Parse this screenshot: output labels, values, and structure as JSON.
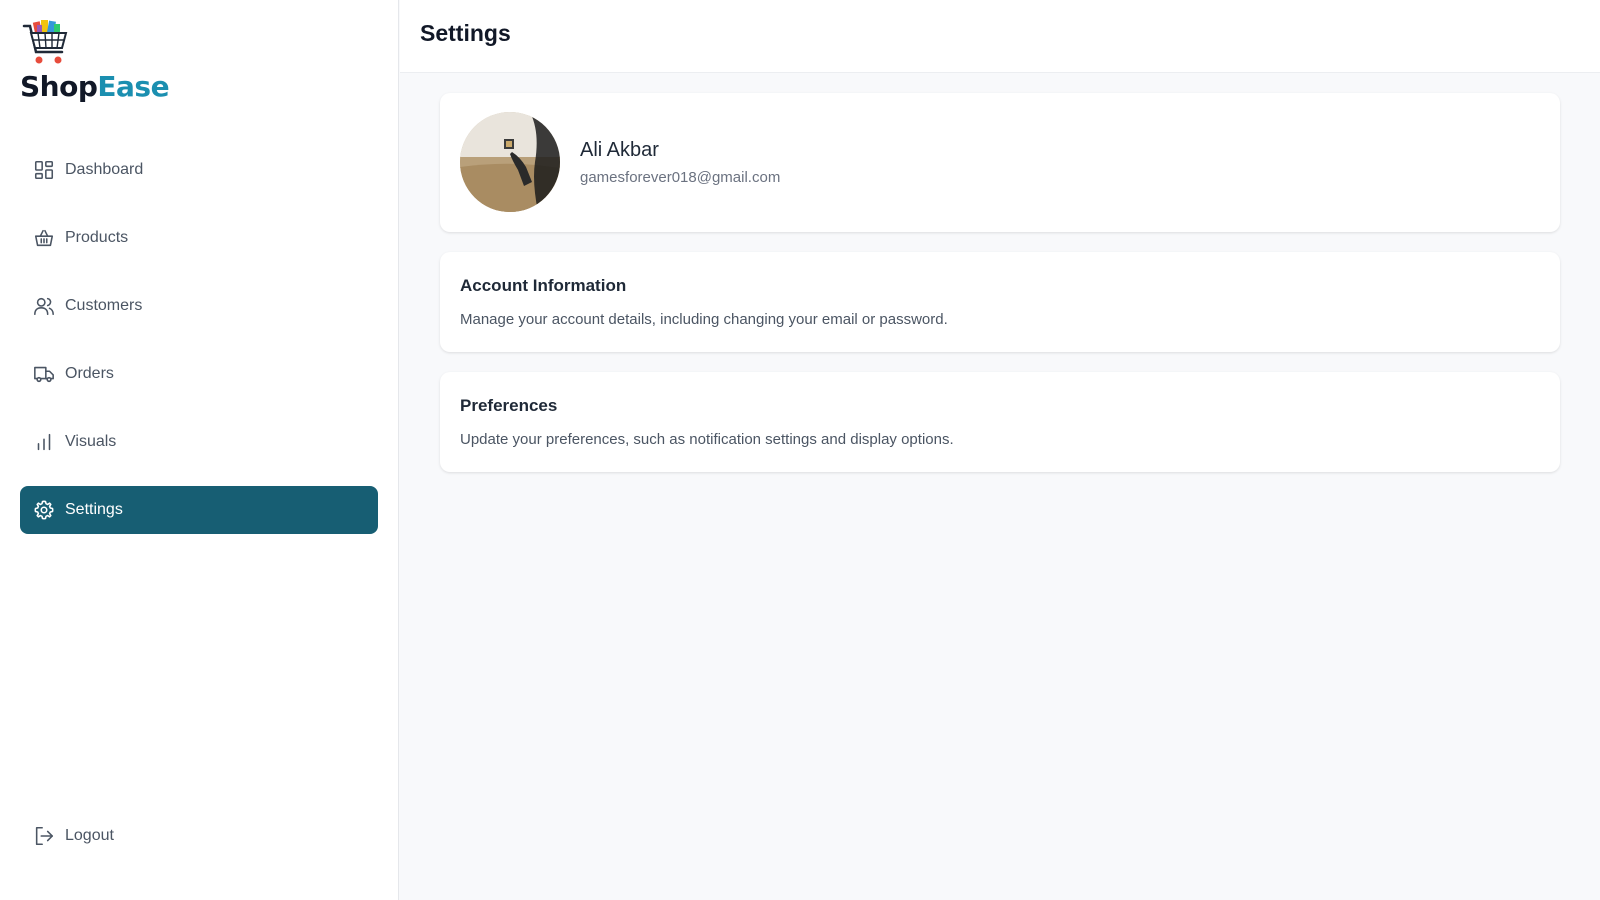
{
  "brand": {
    "name_part1": "Shop",
    "name_part2": "Ease",
    "accent_color": "#1b8fb0",
    "logo_icon": "shopping-cart-icon"
  },
  "sidebar": {
    "items": [
      {
        "label": "Dashboard",
        "icon": "dashboard-icon",
        "active": false
      },
      {
        "label": "Products",
        "icon": "basket-icon",
        "active": false
      },
      {
        "label": "Customers",
        "icon": "users-icon",
        "active": false
      },
      {
        "label": "Orders",
        "icon": "truck-icon",
        "active": false
      },
      {
        "label": "Visuals",
        "icon": "bar-chart-icon",
        "active": false
      },
      {
        "label": "Settings",
        "icon": "gear-icon",
        "active": true
      }
    ],
    "active_color": "#175e73",
    "logout_label": "Logout",
    "logout_icon": "logout-icon"
  },
  "header": {
    "title": "Settings"
  },
  "profile": {
    "name": "Ali Akbar",
    "email": "gamesforever018@gmail.com"
  },
  "sections": [
    {
      "title": "Account Information",
      "description": "Manage your account details, including changing your email or password."
    },
    {
      "title": "Preferences",
      "description": "Update your preferences, such as notification settings and display options."
    }
  ]
}
